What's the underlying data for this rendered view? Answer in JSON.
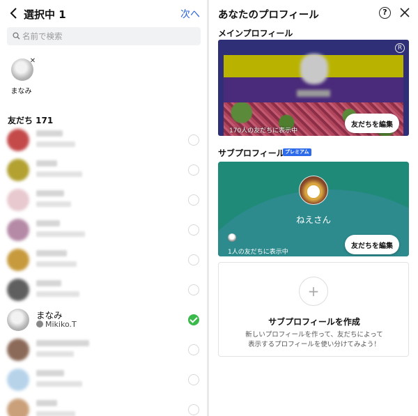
{
  "left_panel": {
    "header": {
      "title": "選択中 1",
      "next_label": "次へ"
    },
    "search": {
      "placeholder": "名前で検索"
    },
    "selected": [
      {
        "name": "まなみ"
      }
    ],
    "friends_header": "友だち 171",
    "rows": [
      {
        "kind": "blurred",
        "avatar_color": "#c44a4a",
        "checked": false
      },
      {
        "kind": "blurred",
        "avatar_color": "#b3a132",
        "checked": false
      },
      {
        "kind": "blurred",
        "avatar_color": "#e7c9cf",
        "checked": false
      },
      {
        "kind": "blurred",
        "avatar_color": "#b58aa6",
        "checked": false
      },
      {
        "kind": "blurred",
        "avatar_color": "#c79a3d",
        "checked": false
      },
      {
        "kind": "blurred",
        "avatar_color": "#5f5f5f",
        "checked": false
      },
      {
        "kind": "named",
        "name": "まなみ",
        "sub": "Mikiko.T",
        "checked": true
      },
      {
        "kind": "blurred",
        "avatar_color": "#8c6a59",
        "checked": false
      },
      {
        "kind": "blurred",
        "avatar_color": "#b7d3ea",
        "checked": false
      },
      {
        "kind": "blurred",
        "avatar_color": "#c9a07a",
        "checked": false
      }
    ]
  },
  "right_panel": {
    "title": "あなたのプロフィール",
    "main_label": "メインプロフィール",
    "main_card": {
      "count_text": "170人の友だちに表示中",
      "edit_label": "友だちを編集",
      "mark": "R"
    },
    "sub_label": "サブプロフィール",
    "premium_badge": "プレミアム",
    "sub_card": {
      "name": "ねえさん",
      "count_text": "1人の友だちに表示中",
      "edit_label": "友だちを編集"
    },
    "create_card": {
      "title": "サブプロフィールを作成",
      "desc_line1": "新しいプロフィールを作って、友だちによって",
      "desc_line2": "表示するプロフィールを使い分けてみよう！"
    }
  }
}
